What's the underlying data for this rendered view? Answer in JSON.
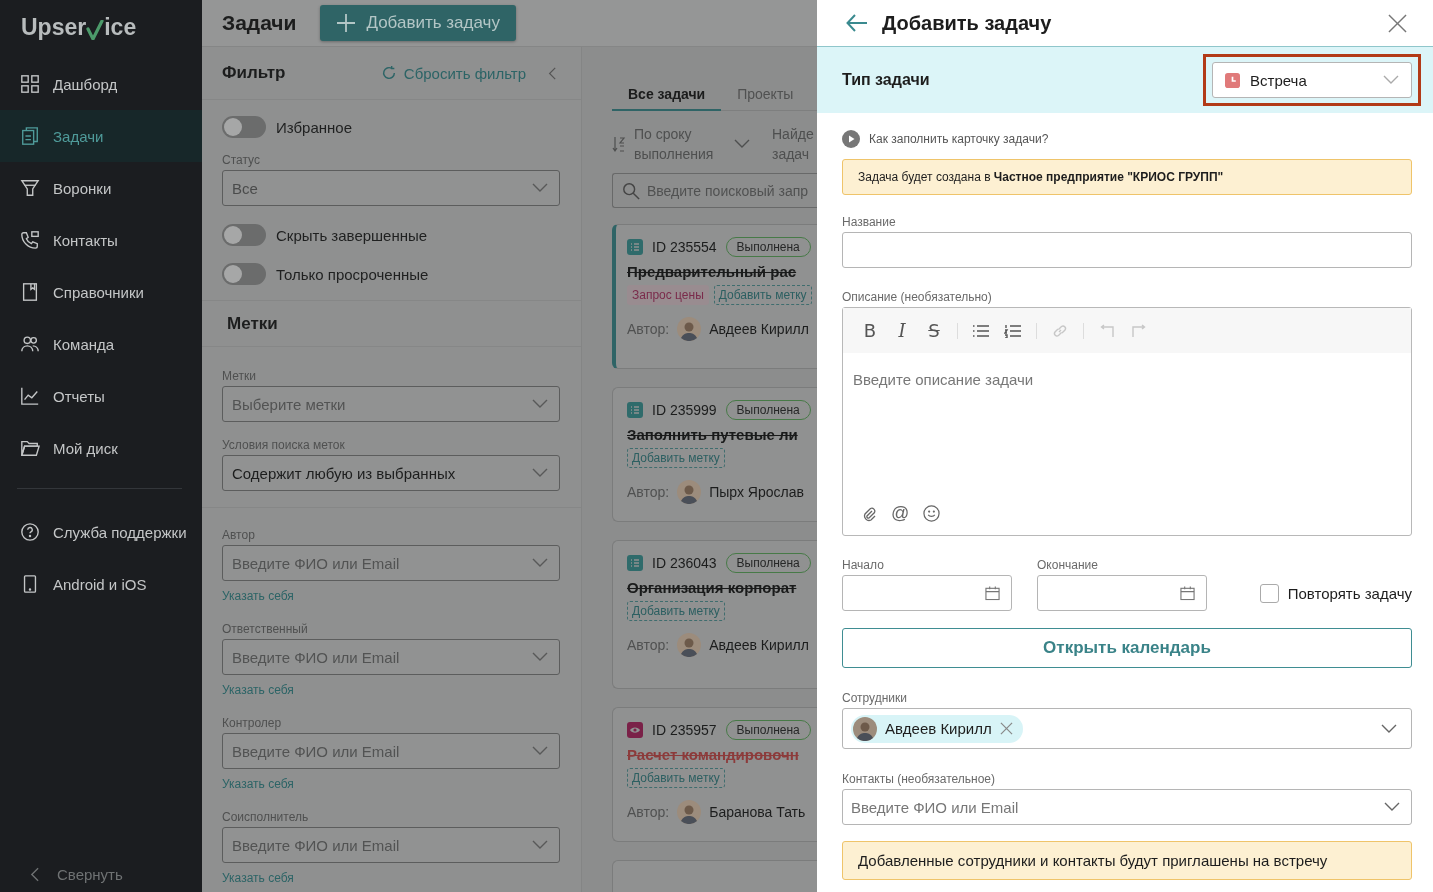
{
  "sidebar": {
    "logo": {
      "before": "Upser",
      "after": "ice"
    },
    "items": [
      {
        "label": "Дашборд",
        "selected": false
      },
      {
        "label": "Задачи",
        "selected": true
      },
      {
        "label": "Воронки",
        "selected": false
      },
      {
        "label": "Контакты",
        "selected": false
      },
      {
        "label": "Справочники",
        "selected": false
      },
      {
        "label": "Команда",
        "selected": false
      },
      {
        "label": "Отчеты",
        "selected": false
      },
      {
        "label": "Мой диск",
        "selected": false
      }
    ],
    "extra_items": [
      {
        "label": "Служба поддержки",
        "selected": false
      },
      {
        "label": "Android и iOS",
        "selected": false
      }
    ],
    "collapse": "Свернуть"
  },
  "header": {
    "title": "Задачи",
    "add_button": "Добавить задачу"
  },
  "filter": {
    "title": "Фильтр",
    "reset": "Сбросить фильтр",
    "rows": [
      {
        "kind": "toggle",
        "label": "Избранное",
        "on": false
      },
      {
        "kind": "select",
        "label": "Статус",
        "value": "Все"
      },
      {
        "kind": "toggle",
        "label": "Скрыть завершенные",
        "on": false
      },
      {
        "kind": "toggle",
        "label": "Только просроченные",
        "on": false
      }
    ],
    "tags_title": "Метки",
    "tag_fields": [
      {
        "label": "Метки",
        "placeholder": "Выберите метки"
      },
      {
        "label": "Условия поиска меток",
        "value": "Содержит любую из выбранных"
      }
    ],
    "people": [
      {
        "label": "Автор",
        "placeholder": "Введите ФИО или Email",
        "link": "Указать себя"
      },
      {
        "label": "Ответственный",
        "placeholder": "Введите ФИО или Email",
        "link": "Указать себя"
      },
      {
        "label": "Контролер",
        "placeholder": "Введите ФИО или Email",
        "link": "Указать себя"
      },
      {
        "label": "Соисполнитель",
        "placeholder": "Введите ФИО или Email",
        "link": "Указать себя"
      }
    ]
  },
  "tasks": {
    "tabs": [
      {
        "label": "Все задачи",
        "selected": true
      },
      {
        "label": "Проекты",
        "selected": false
      }
    ],
    "sort": "По сроку выполнения",
    "found": "Найде задач",
    "search_placeholder": "Введите поисковый запр",
    "cards": [
      {
        "kind": "list",
        "id": "ID 235554",
        "status": "Выполнена",
        "title": "Предварительный рас",
        "overdue": false,
        "selected": true,
        "tags": [
          "Запрос цены"
        ],
        "add_tag": "Добавить метку",
        "author_label": "Автор:",
        "author": "Авдеев Кирилл"
      },
      {
        "kind": "list",
        "id": "ID 235999",
        "status": "Выполнена",
        "title": "Заполнить путевые ли",
        "overdue": false,
        "selected": false,
        "add_tag": "Добавить метку",
        "author_label": "Автор:",
        "author": "Пырх Ярослав"
      },
      {
        "kind": "list",
        "id": "ID 236043",
        "status": "Выполнена",
        "title": "Организация корпорат",
        "overdue": false,
        "selected": false,
        "add_tag": "Добавить метку",
        "author_label": "Автор:",
        "author": "Авдеев Кирилл"
      },
      {
        "kind": "meeting",
        "id": "ID 235957",
        "status": "Выполнена",
        "title": "Расчет командировочн",
        "overdue": true,
        "selected": false,
        "add_tag": "Добавить метку",
        "author_label": "Автор:",
        "author": "Баранова Тать"
      }
    ]
  },
  "form": {
    "title": "Добавить задачу",
    "type_label": "Тип задачи",
    "type_value": "Встреча",
    "type_highlighted": true,
    "help": "Как заполнить карточку задачи?",
    "company_note": "Задача будет создана в **Частное предприятие \"КРИОС ГРУПП\"**",
    "name_label": "Название",
    "desc_label": "Описание (необязательно)",
    "toolbar": [
      {
        "kind": "bold",
        "glyph": "B",
        "disabled": false
      },
      {
        "kind": "italic",
        "glyph": "I",
        "disabled": false
      },
      {
        "kind": "strike",
        "glyph": "S",
        "disabled": false
      },
      {
        "kind": "bullets",
        "disabled": false
      },
      {
        "kind": "numbers",
        "disabled": false
      },
      {
        "kind": "link",
        "disabled": true
      },
      {
        "kind": "undo",
        "disabled": true
      },
      {
        "kind": "redo",
        "disabled": true
      }
    ],
    "desc_placeholder": "Введите описание задачи",
    "mention": "@",
    "start_label": "Начало",
    "end_label": "Окончание",
    "repeat": {
      "label": "Повторять задачу",
      "checked": false
    },
    "calendar_button": "Открыть календарь",
    "employees_label": "Сотрудники",
    "employees": [
      {
        "name": "Авдеев Кирилл"
      }
    ],
    "contacts_label": "Контакты (необязательное)",
    "contacts_placeholder": "Введите ФИО или Email",
    "invite_note": "Добавленные сотрудники и контакты будут приглашены на встречу"
  }
}
